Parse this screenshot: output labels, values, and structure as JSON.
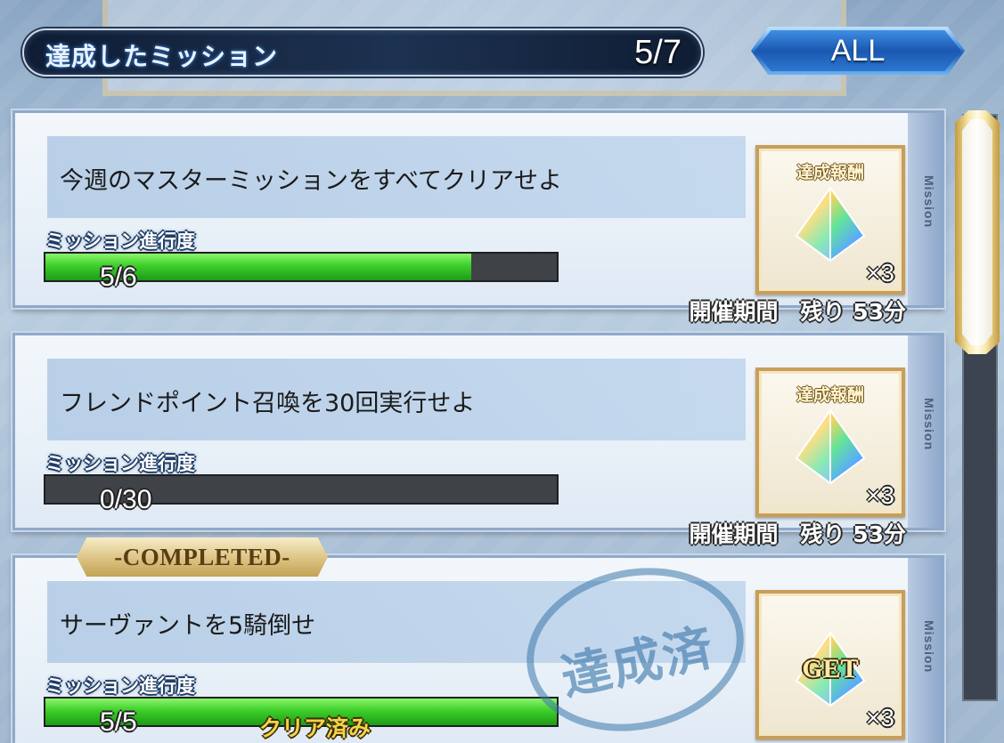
{
  "header": {
    "title": "達成したミッション",
    "count": "5/7"
  },
  "filter": {
    "label": "ALL"
  },
  "missions": [
    {
      "text": "今週のマスターミッションをすべてクリアせよ",
      "progress_label": "ミッション進行度",
      "progress_value": "5/6",
      "progress_fraction": 0.833,
      "period": "開催期間　残り 53分",
      "reward_title": "達成報酬",
      "reward_qty": "×3",
      "reward_icon": "saint-quartz-icon",
      "edge_label": "Mission"
    },
    {
      "text": "フレンドポイント召喚を30回実行せよ",
      "progress_label": "ミッション進行度",
      "progress_value": "0/30",
      "progress_fraction": 0,
      "period": "開催期間　残り 53分",
      "reward_title": "達成報酬",
      "reward_qty": "×3",
      "reward_icon": "saint-quartz-icon",
      "edge_label": "Mission"
    },
    {
      "text": "サーヴァントを5騎倒せ",
      "progress_label": "ミッション進行度",
      "progress_value": "5/5",
      "progress_fraction": 1,
      "clear_label": "クリア済み",
      "reward_get": "GET",
      "reward_qty": "×3",
      "reward_icon": "saint-quartz-icon",
      "edge_label": "Mission",
      "completed_banner": "-COMPLETED-",
      "stamp": "達成済"
    }
  ],
  "colors": {
    "progress_fill": "#3dcf2a",
    "header_bg": "#0f1c33",
    "reward_border": "#c79e5a",
    "stamp": "#3c78aa"
  }
}
